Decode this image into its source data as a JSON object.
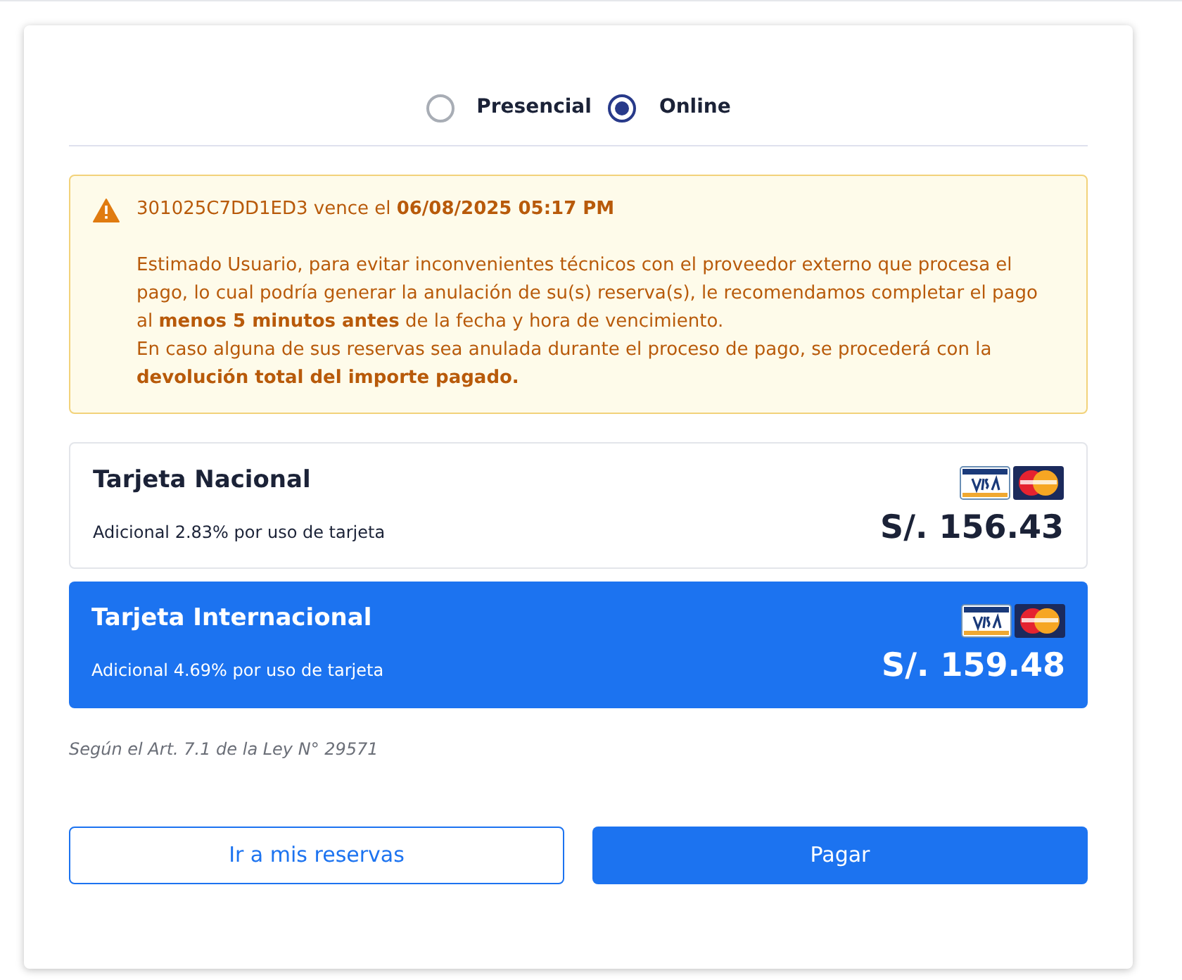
{
  "modes": [
    {
      "label": "Presencial",
      "selected": false
    },
    {
      "label": "Online",
      "selected": true
    }
  ],
  "alert": {
    "title": "301025C7DD1ED3 vence el **06/08/2025 05:17 PM**",
    "paragraphs": [
      "Estimado Usuario, para evitar inconvenientes técnicos con el proveedor externo que procesa el pago, lo cual podría generar la anulación de su(s) reserva(s), le recomendamos completar el pago al **menos 5 minutos antes** de la fecha y hora de vencimiento.",
      "En caso alguna de sus reservas sea anulada durante el proceso de pago, se procederá con la **devolución total del importe pagado.**"
    ]
  },
  "options": [
    {
      "title": "Tarjeta Nacional",
      "note": "Adicional 2.83% por uso de tarjeta",
      "amount": "S/. 156.43",
      "selected": false
    },
    {
      "title": "Tarjeta Internacional",
      "note": "Adicional 4.69% por uso de tarjeta",
      "amount": "S/. 159.48",
      "selected": true
    }
  ],
  "legal_note": "Según el Art. 7.1 de la Ley N° 29571",
  "buttons": [
    {
      "label": "Ir a mis reservas",
      "kind": "secondary"
    },
    {
      "label": "Pagar",
      "kind": "primary"
    }
  ]
}
